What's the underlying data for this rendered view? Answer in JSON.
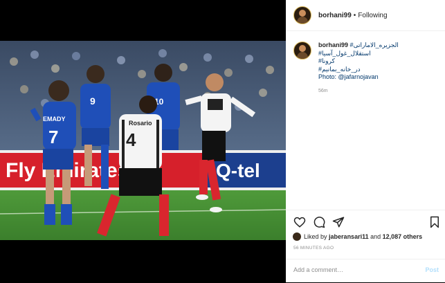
{
  "post": {
    "username": "borhani99",
    "follow_sep": "•",
    "follow_status": "Following"
  },
  "caption": {
    "username": "borhani99",
    "line1": "#الجزیره_الاماراتی",
    "tags": [
      "#استقلال_غول_آسیا",
      "#کرونا",
      "#در_خانه_بمانیم"
    ],
    "photo_credit": "Photo: @jafarnojavan",
    "time": "56m"
  },
  "likes": {
    "prefix": "Liked by",
    "user": "jaberansari11",
    "and": "and",
    "count": "12,087 others"
  },
  "timeago": "56 MINUTES AGO",
  "comment": {
    "placeholder": "Add a comment…",
    "post_label": "Post"
  },
  "photo": {
    "jersey_7": "7",
    "jersey_4": "4",
    "jersey_9": "9",
    "jersey_10": "10",
    "name_7": "EMADY",
    "name_4": "Rosario",
    "ad_left": "Fly Emirates",
    "ad_right": "Q-tel"
  },
  "colors": {
    "blue_kit": "#1f4fb8",
    "link": "#00376b",
    "muted": "#8e8e8e",
    "post_disabled": "#b2dffc"
  }
}
